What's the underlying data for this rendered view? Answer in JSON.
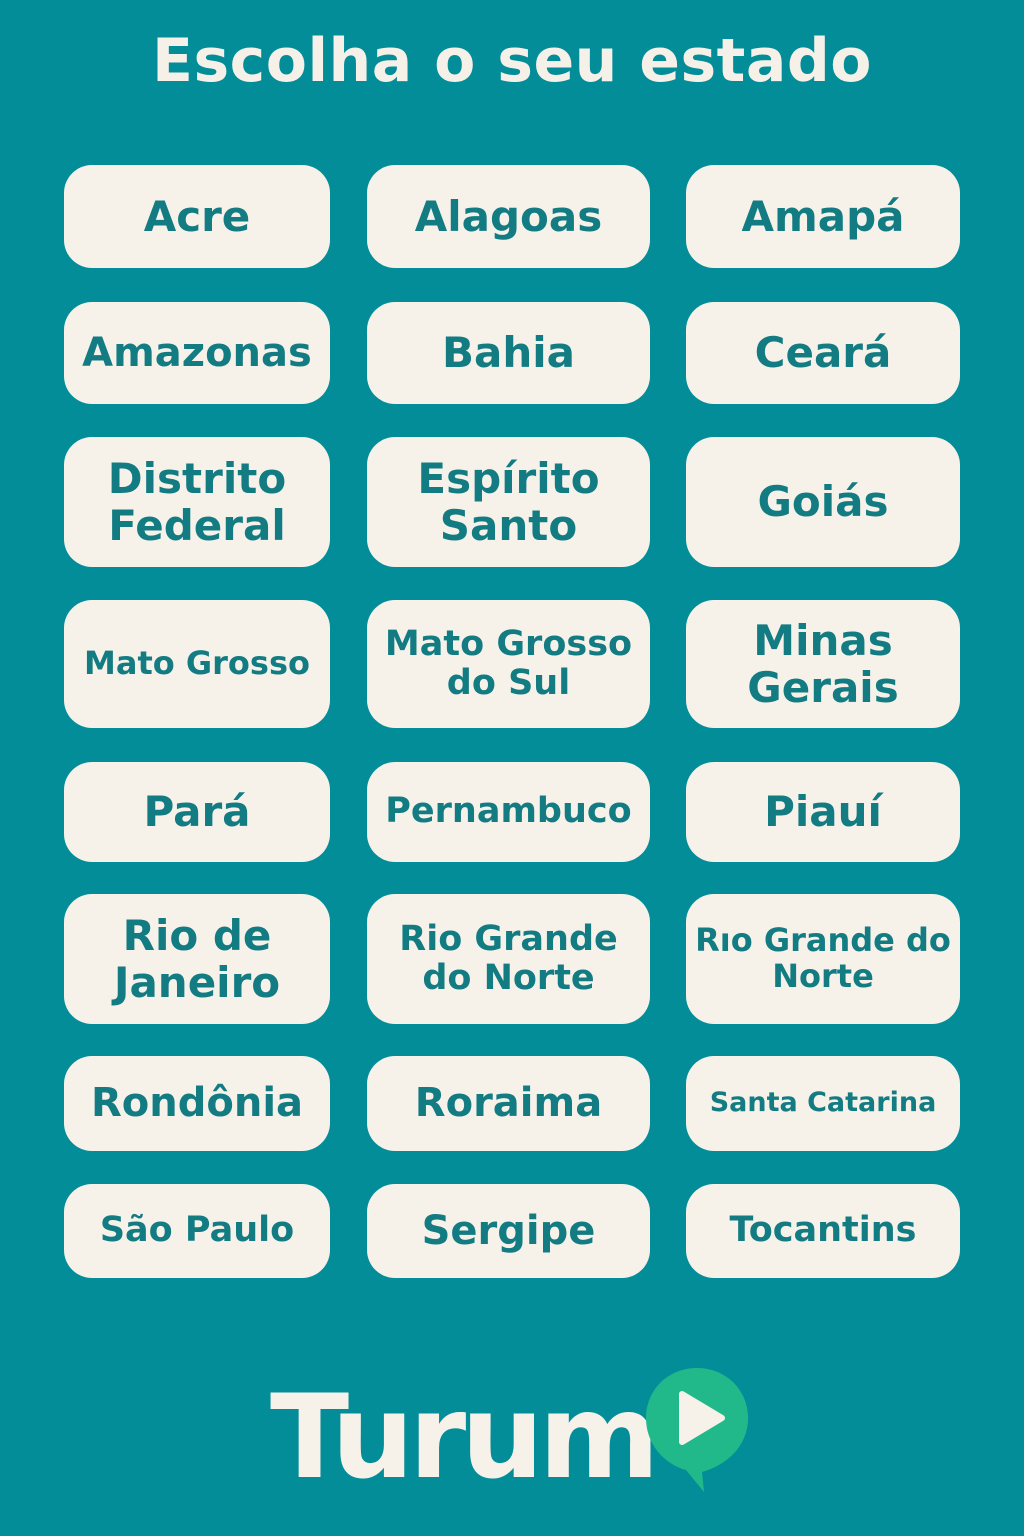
{
  "header": {
    "title": "Escolha o seu estado"
  },
  "states": [
    "Acre",
    "Alagoas",
    "Amapá",
    "Amazonas",
    "Bahia",
    "Ceará",
    "Distrito Federal",
    "Espírito Santo",
    "Goiás",
    "Mato Grosso",
    "Mato Grosso do Sul",
    "Minas Gerais",
    "Pará",
    "Pernambuco",
    "Piauí",
    "Rio de Janeiro",
    "Rio Grande do Norte",
    "Rıo Grande do Norte",
    "Rondônia",
    "Roraima",
    "Santa Catarina",
    "São Paulo",
    "Sergipe",
    "Tocantins"
  ],
  "brand": {
    "name": "Turum",
    "icon": "play-pin-icon",
    "icon_color": "#22b98a",
    "accent": "#f6f2ea"
  },
  "colors": {
    "background": "#038d98",
    "button_bg": "#f6f2ea",
    "button_text": "#137c83"
  }
}
